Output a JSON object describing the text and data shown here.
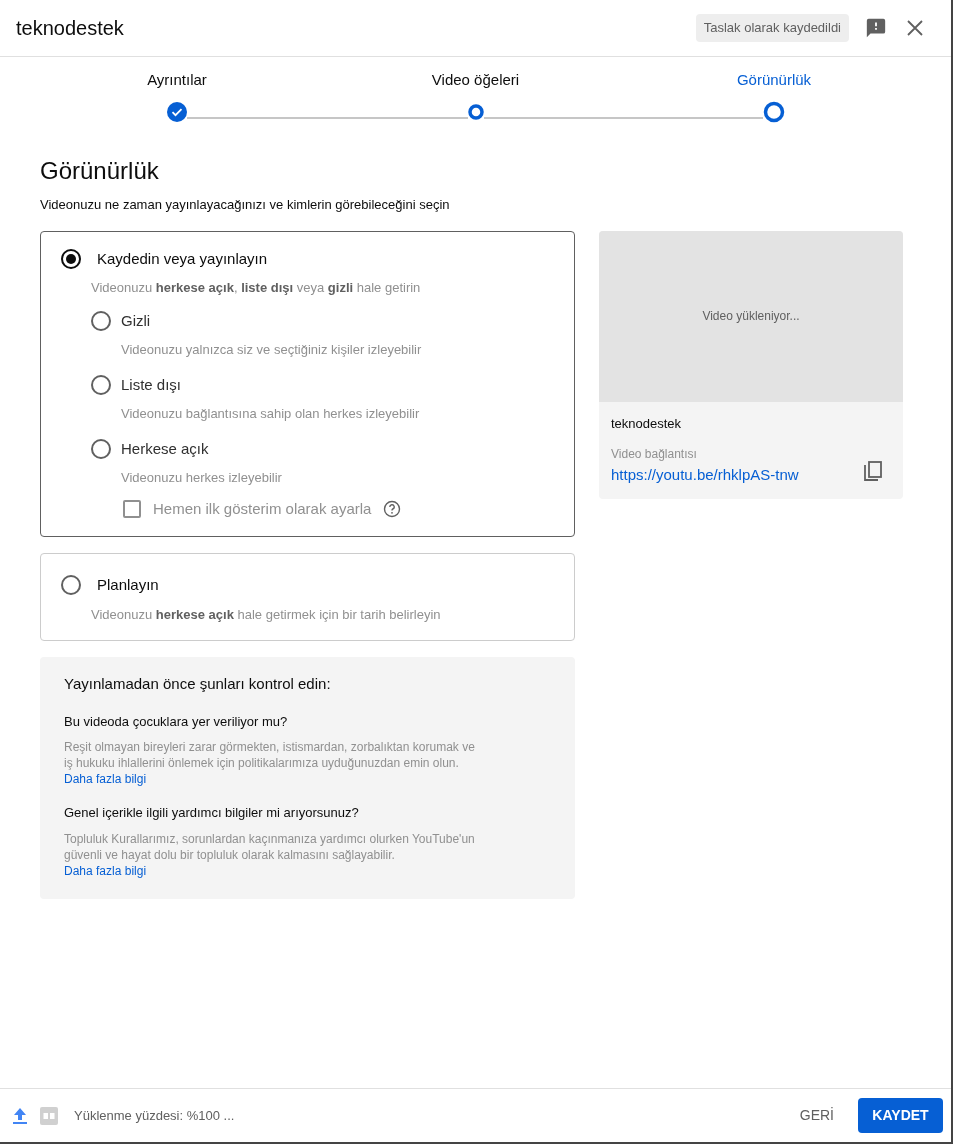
{
  "header": {
    "title": "teknodestek",
    "draft_badge": "Taslak olarak kaydedildi"
  },
  "steps": [
    {
      "label": "Ayrıntılar",
      "kind": "completed",
      "selected": false
    },
    {
      "label": "Video öğeleri",
      "kind": "open",
      "selected": false
    },
    {
      "label": "Görünürlük",
      "kind": "open",
      "selected": true
    }
  ],
  "page": {
    "title": "Görünürlük",
    "subtitle": "Videonuzu ne zaman yayınlayacağınızı ve kimlerin görebileceğini seçin"
  },
  "publish_card": {
    "label": "Kaydedin veya yayınlayın",
    "selected": true,
    "description": "Videonuzu **herkese açık**, **liste dışı** veya **gizli** hale getirin",
    "options": [
      {
        "label": "Gizli",
        "description": "Videonuzu yalnızca siz ve seçtiğiniz kişiler izleyebilir",
        "selected": false
      },
      {
        "label": "Liste dışı",
        "description": "Videonuzu bağlantısına sahip olan herkes izleyebilir",
        "selected": false
      },
      {
        "label": "Herkese açık",
        "description": "Videonuzu herkes izleyebilir",
        "selected": false
      }
    ],
    "premiere": {
      "label": "Hemen ilk gösterim olarak ayarla",
      "checked": false
    }
  },
  "schedule_card": {
    "label": "Planlayın",
    "selected": false,
    "description": "Videonuzu **herkese açık** hale getirmek için bir tarih belirleyin"
  },
  "checklist": {
    "title": "Yayınlamadan önce şunları kontrol edin:",
    "sections": [
      {
        "question": "Bu videoda çocuklara yer veriliyor mu?",
        "text": "Reşit olmayan bireyleri zarar görmekten, istismardan, zorbalıktan korumak ve iş hukuku ihlallerini önlemek için politikalarımıza uyduğunuzdan emin olun.",
        "link": "Daha fazla bilgi"
      },
      {
        "question": "Genel içerikle ilgili yardımcı bilgiler mi arıyorsunuz?",
        "text": "Topluluk Kurallarımız, sorunlardan kaçınmanıza yardımcı olurken YouTube'un güvenli ve hayat dolu bir topluluk olarak kalmasını sağlayabilir.",
        "link": "Daha fazla bilgi"
      }
    ]
  },
  "preview": {
    "loading_text": "Video yükleniyor...",
    "channel": "teknodestek",
    "link_label": "Video bağlantısı",
    "link": "https://youtu.be/rhklpAS-tnw"
  },
  "footer": {
    "status": "Yüklenme yüzdesi: %100 ...",
    "back": "GERİ",
    "save": "KAYDET"
  }
}
